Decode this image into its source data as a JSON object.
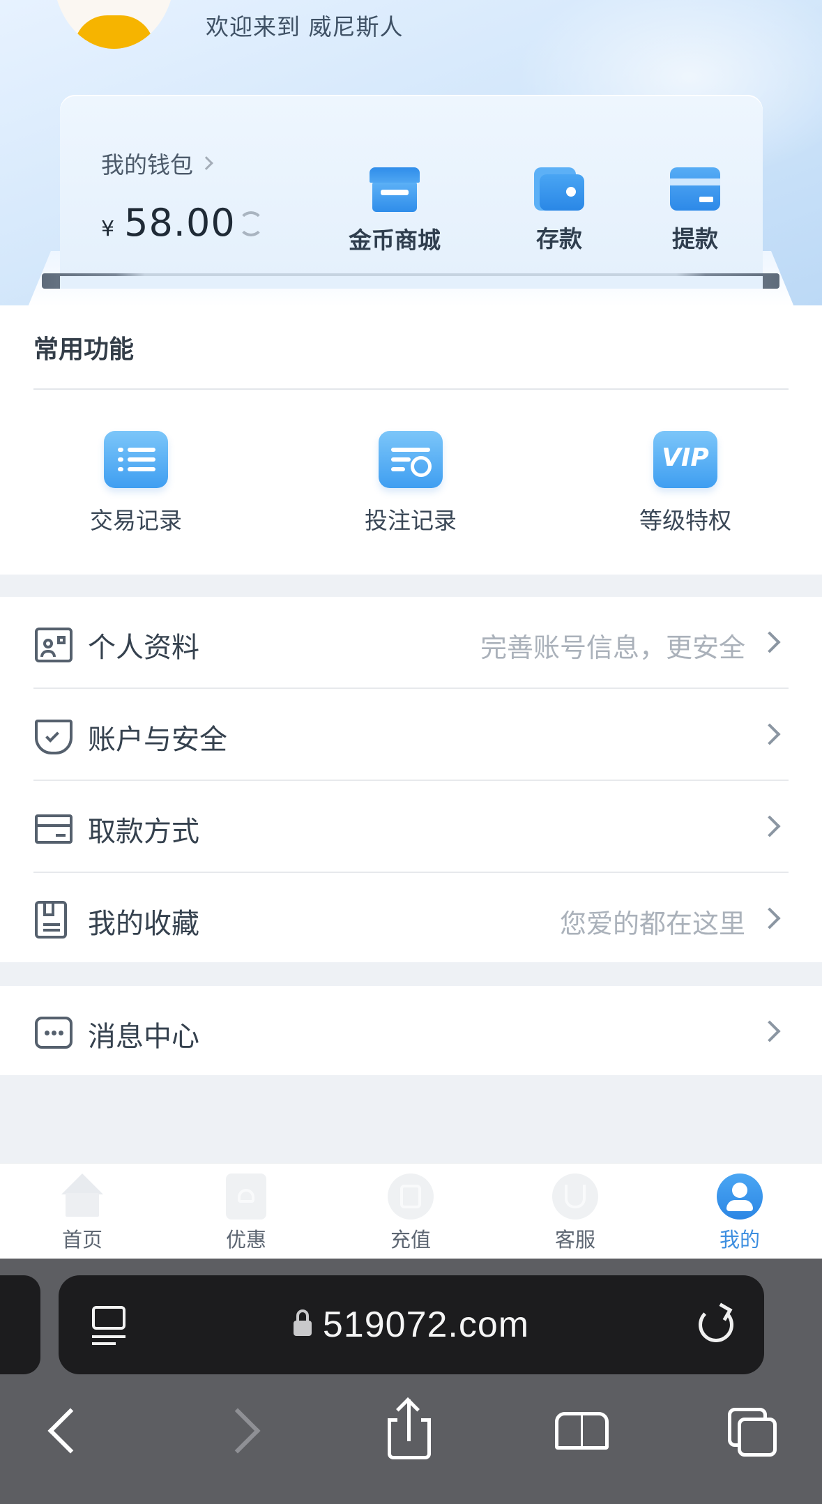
{
  "header": {
    "welcome_text": "欢迎来到 威尼斯人"
  },
  "wallet": {
    "link_label": "我的钱包",
    "currency_symbol": "¥",
    "balance": "58.00",
    "actions": [
      {
        "label": "金币商城",
        "icon": "store-icon"
      },
      {
        "label": "存款",
        "icon": "wallet-icon"
      },
      {
        "label": "提款",
        "icon": "card-icon"
      }
    ]
  },
  "common": {
    "title": "常用功能",
    "items": [
      {
        "label": "交易记录",
        "icon": "list-icon"
      },
      {
        "label": "投注记录",
        "icon": "bet-record-icon"
      },
      {
        "label": "等级特权",
        "icon": "vip-icon",
        "icon_text": "VIP"
      }
    ]
  },
  "menu": {
    "items": [
      {
        "label": "个人资料",
        "hint": "完善账号信息，更安全",
        "icon": "profile-card-icon"
      },
      {
        "label": "账户与安全",
        "hint": "",
        "icon": "shield-icon"
      },
      {
        "label": "取款方式",
        "hint": "",
        "icon": "bank-card-icon"
      },
      {
        "label": "我的收藏",
        "hint": "您爱的都在这里",
        "icon": "bookmark-icon"
      }
    ],
    "messages": {
      "label": "消息中心",
      "icon": "message-icon"
    }
  },
  "tabbar": {
    "items": [
      {
        "label": "首页",
        "icon": "home-icon"
      },
      {
        "label": "优惠",
        "icon": "promo-icon"
      },
      {
        "label": "充值",
        "icon": "recharge-icon"
      },
      {
        "label": "客服",
        "icon": "support-icon"
      },
      {
        "label": "我的",
        "icon": "user-icon"
      }
    ],
    "active_index": 4,
    "active_color": "#3c8ee0"
  },
  "browser": {
    "url": "519072.com"
  }
}
